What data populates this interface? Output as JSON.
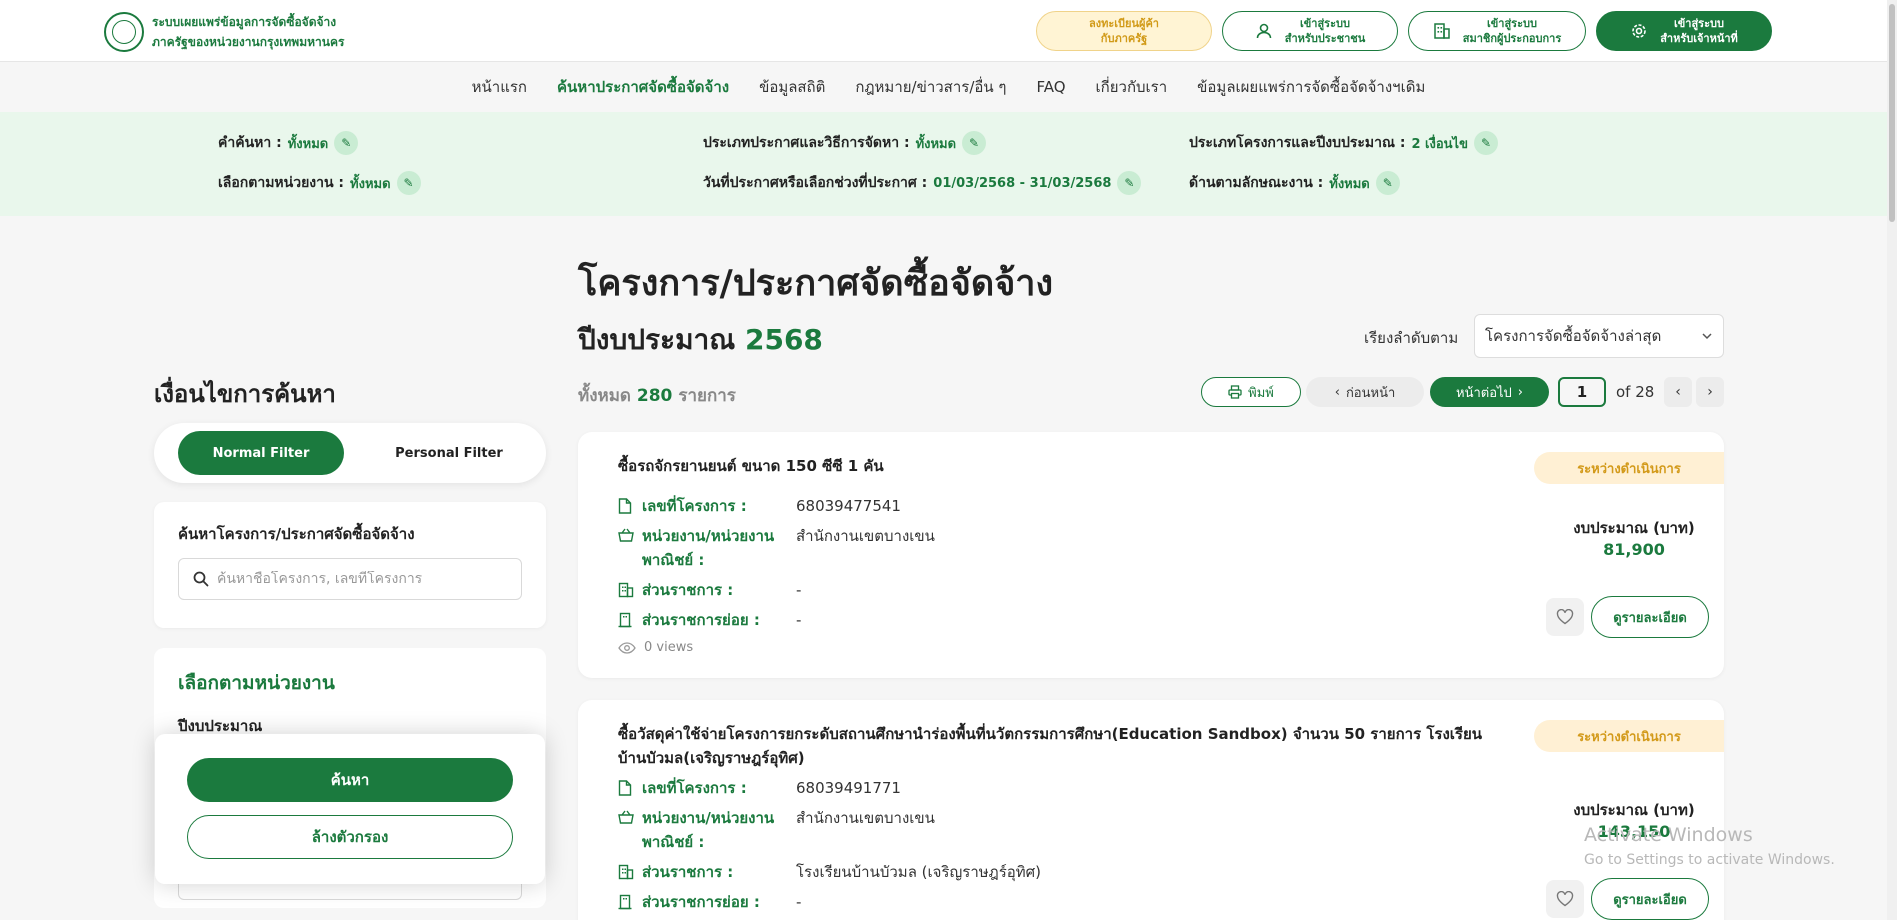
{
  "header": {
    "brand_line1": "ระบบเผยแพร่ข้อมูลการจัดซื้อจัดจ้าง",
    "brand_line2": "ภาครัฐของหน่วยงานกรุงเทพมหานคร",
    "register_line1": "ลงทะเบียนผู้ค้า",
    "register_line2": "กับภาครัฐ",
    "citizen_line1": "เข้าสู่ระบบ",
    "citizen_line2": "สำหรับประชาชน",
    "member_line1": "เข้าสู่ระบบ",
    "member_line2": "สมาชิกผู้ประกอบการ",
    "officer_line1": "เข้าสู่ระบบ",
    "officer_line2": "สำหรับเจ้าหน้าที่"
  },
  "nav": {
    "items": [
      {
        "label": "หน้าแรก"
      },
      {
        "label": "ค้นหาประกาศจัดซื้อจัดจ้าง"
      },
      {
        "label": "ข้อมูลสถิติ"
      },
      {
        "label": "กฎหมาย/ข่าวสาร/อื่น ๆ"
      },
      {
        "label": "FAQ"
      },
      {
        "label": "เกี่ยวกับเรา"
      },
      {
        "label": "ข้อมูลเผยแพร่การจัดซื้อจัดจ้างฯเดิม"
      }
    ],
    "active_index": 1
  },
  "criteria": {
    "keyword_label": "คำค้นหา :",
    "keyword_value": "ทั้งหมด",
    "type_label": "ประเภทประกาศและวิธีการจัดหา :",
    "type_value": "ทั้งหมด",
    "project_type_label": "ประเภทโครงการและปีงบประมาณ :",
    "project_type_value": "2 เงื่อนไข",
    "agency_label": "เลือกตามหน่วยงาน :",
    "agency_value": "ทั้งหมด",
    "date_label": "วันที่ประกาศหรือเลือกช่วงที่ประกาศ :",
    "date_value": "01/03/2568 - 31/03/2568",
    "work_label": "ด้านตามลักษณะงาน :",
    "work_value": "ทั้งหมด"
  },
  "sidebar": {
    "title": "เงื่อนไขการค้นหา",
    "normal_filter": "Normal Filter",
    "personal_filter": "Personal Filter",
    "search_label": "ค้นหาโครงการ/ประกาศจัดซื้อจัดจ้าง",
    "search_placeholder": "ค้นหาชื่อโครงการ, เลขที่โครงการ",
    "agency_title": "เลือกตามหน่วยงาน",
    "budget_year_label": "ปีงบประมาณ",
    "search_button": "ค้นหา",
    "clear_button": "ล้างตัวกรอง"
  },
  "main": {
    "title": "โครงการ/ประกาศจัดซื้อจัดจ้าง",
    "fy_label": "ปีงบประมาณ",
    "fy_value": "2568",
    "sort_label": "เรียงลำดับตาม",
    "sort_value": "โครงการจัดซื้อจัดจ้างล่าสุด",
    "total_label": "ทั้งหมด",
    "total_count": "280",
    "total_unit": "รายการ",
    "print": "พิมพ์",
    "prev": "ก่อนหน้า",
    "next": "หน้าต่อไป",
    "page": "1",
    "of_total": "of 28"
  },
  "labels": {
    "project_no": "เลขที่โครงการ :",
    "agency_line1": "หน่วยงาน/หน่วยงาน",
    "agency_line2": "พาณิชย์ :",
    "division": "ส่วนราชการ :",
    "sub_division": "ส่วนราชการย่อย :",
    "budget": "งบประมาณ (บาท)",
    "detail": "ดูรายละเอียด"
  },
  "projects": [
    {
      "title": "ซื้อรถจักรยานยนต์ ขนาด 150 ซีซี 1 คัน",
      "status": "ระหว่างดำเนินการ",
      "project_no": "68039477541",
      "agency": "สำนักงานเขตบางเขน",
      "division": "-",
      "sub_division": "-",
      "views": "0 views",
      "budget": "81,900"
    },
    {
      "title": "ซื้อวัสดุค่าใช้จ่ายโครงการยกระดับสถานศึกษานำร่องพื้นที่นวัตกรรมการศึกษา(Education Sandbox) จำนวน 50 รายการ โรงเรียนบ้านบัวมล(เจริญราษฎร์อุทิศ)",
      "status": "ระหว่างดำเนินการ",
      "project_no": "68039491771",
      "agency": "สำนักงานเขตบางเขน",
      "division": "โรงเรียนบ้านบัวมล (เจริญราษฎร์อุทิศ)",
      "sub_division": "-",
      "budget": "143,150"
    }
  ],
  "watermark": {
    "line1": "Activate Windows",
    "line2": "Go to Settings to activate Windows."
  },
  "colors": {
    "primary": "#1b7a3e",
    "status": "#d39a1a",
    "band": "#e9f7ec"
  }
}
